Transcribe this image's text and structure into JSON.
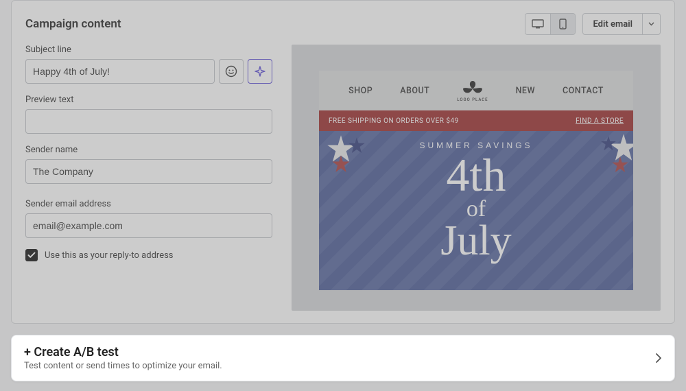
{
  "header": {
    "title": "Campaign content",
    "edit_label": "Edit email"
  },
  "form": {
    "subject_label": "Subject line",
    "subject_value": "Happy 4th of July!",
    "preview_label": "Preview text",
    "preview_value": "",
    "sender_name_label": "Sender name",
    "sender_name_value": "The Company",
    "sender_email_label": "Sender email address",
    "sender_email_value": "email@example.com",
    "reply_to_label": "Use this as your reply-to address",
    "reply_to_checked": true
  },
  "preview": {
    "nav": {
      "shop": "SHOP",
      "about": "ABOUT",
      "new": "NEW",
      "contact": "CONTACT",
      "logo_text": "LOGO PLACE"
    },
    "banner": {
      "left": "FREE SHIPPING ON ORDERS OVER $49",
      "right": "FIND A STORE"
    },
    "hero": {
      "eyebrow": "SUMMER SAVINGS",
      "line1": "4th",
      "line2": "of",
      "line3": "July"
    }
  },
  "ab": {
    "title": "+ Create A/B test",
    "subtitle": "Test content or send times to optimize your email."
  }
}
